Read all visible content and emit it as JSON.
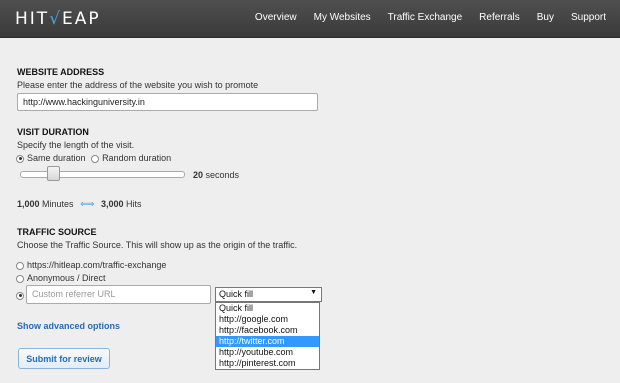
{
  "logo": {
    "text_a": "HIT",
    "text_check": "√",
    "text_b": "EAP"
  },
  "nav": [
    "Overview",
    "My Websites",
    "Traffic Exchange",
    "Referrals",
    "Buy",
    "Support"
  ],
  "website": {
    "title": "WEBSITE ADDRESS",
    "desc": "Please enter the address of the website you wish to promote",
    "value": "http://www.hackinguniversity.in"
  },
  "visit": {
    "title": "VISIT DURATION",
    "desc": "Specify the length of the visit.",
    "opt_same": "Same duration",
    "opt_random": "Random duration",
    "seconds_value": "20",
    "seconds_unit": "seconds",
    "slider_fraction": 0.2,
    "minutes_value": "1,000",
    "minutes_unit": "Minutes",
    "hits_value": "3,000",
    "hits_unit": "Hits"
  },
  "traffic": {
    "title": "TRAFFIC SOURCE",
    "desc": "Choose the Traffic Source. This will show up as the origin of the traffic.",
    "opt_url": "https://hitleap.com/traffic-exchange",
    "opt_anon": "Anonymous / Direct",
    "custom_placeholder": "Custom referrer URL",
    "select_value": "Quick fill",
    "options": [
      "Quick fill",
      "http://google.com",
      "http://facebook.com",
      "http://twitter.com",
      "http://youtube.com",
      "http://pinterest.com"
    ],
    "highlighted": "http://twitter.com"
  },
  "advanced_link": "Show advanced options",
  "submit_label": "Submit for review",
  "colors": {
    "accent": "#2a6ab3",
    "topbar": "#444444",
    "highlight": "#3399ff"
  }
}
